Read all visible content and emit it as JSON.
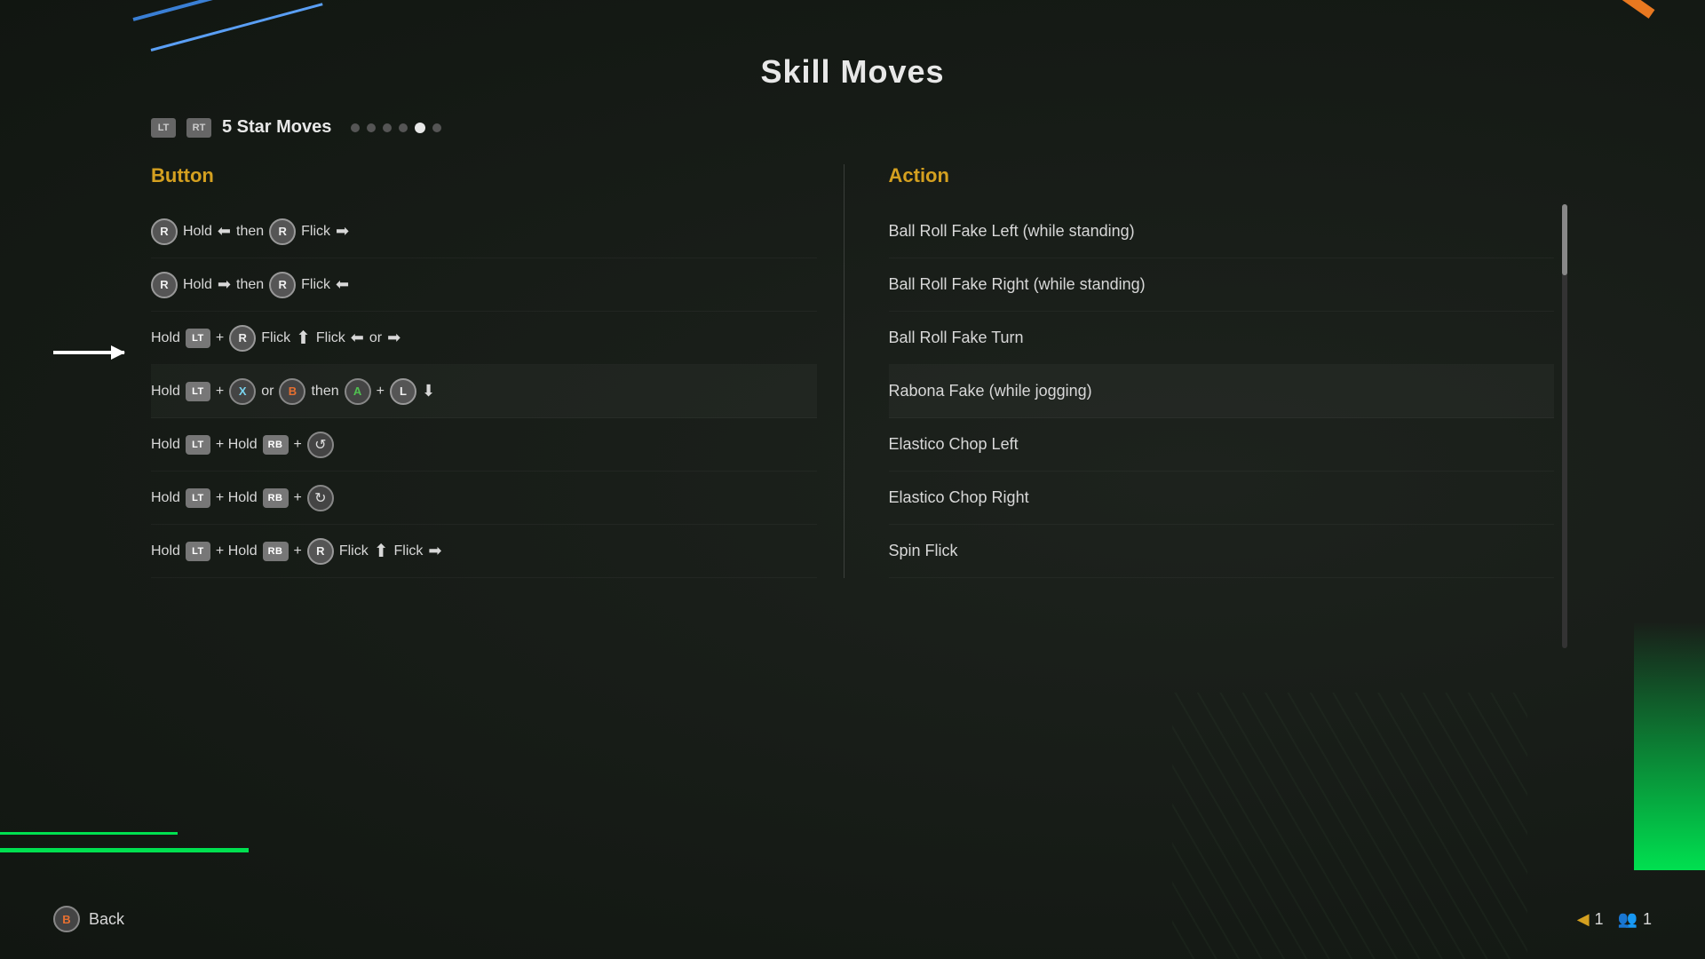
{
  "page": {
    "title": "Skill Moves",
    "background": "#1a1f1a"
  },
  "tabs": {
    "left_badge": "LT",
    "right_badge": "RT",
    "current_tab": "5 Star Moves",
    "dots": [
      {
        "active": false
      },
      {
        "active": false
      },
      {
        "active": false
      },
      {
        "active": false
      },
      {
        "active": true
      },
      {
        "active": false
      }
    ]
  },
  "columns": {
    "button_header": "Button",
    "action_header": "Action"
  },
  "moves": [
    {
      "id": 1,
      "button_desc": "R Hold ← then R Flick →",
      "action": "Ball Roll Fake Left (while standing)"
    },
    {
      "id": 2,
      "button_desc": "R Hold → then R Flick ←",
      "action": "Ball Roll Fake Right (while standing)"
    },
    {
      "id": 3,
      "button_desc": "Hold LT + R Flick ↑ Flick ← or →",
      "action": "Ball Roll Fake Turn"
    },
    {
      "id": 4,
      "button_desc": "Hold LT + X or B then A + L↓",
      "action": "Rabona Fake (while jogging)",
      "highlighted": true
    },
    {
      "id": 5,
      "button_desc": "Hold LT + Hold RB + R rotate-left",
      "action": "Elastico Chop Left"
    },
    {
      "id": 6,
      "button_desc": "Hold LT + Hold RB + R rotate-right",
      "action": "Elastico Chop Right"
    },
    {
      "id": 7,
      "button_desc": "Hold LT + Hold RB + R Flick ↑ Flick →",
      "action": "Spin Flick"
    }
  ],
  "bottom": {
    "back_label": "Back",
    "back_button": "B",
    "page_number": "1",
    "player_count": "1"
  }
}
